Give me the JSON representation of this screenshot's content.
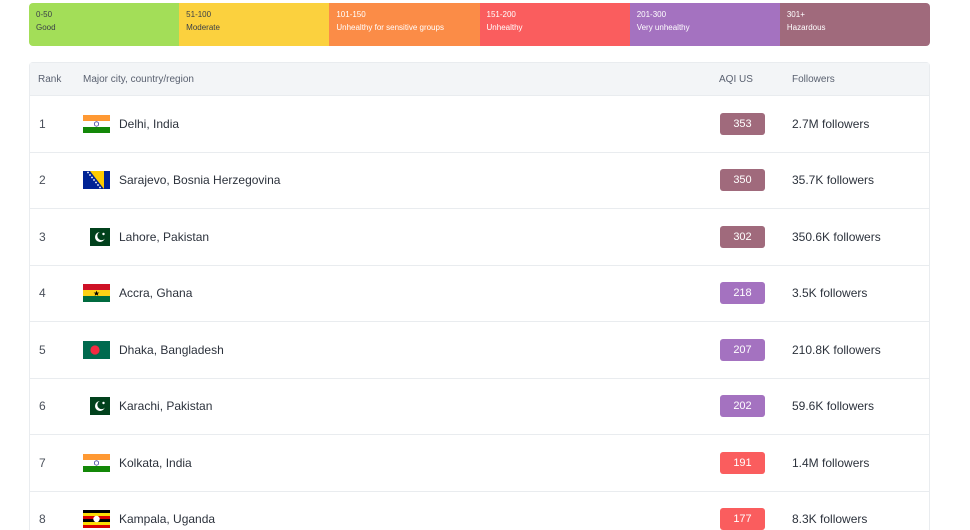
{
  "legend": [
    {
      "range": "0-50",
      "label": "Good",
      "color": "#a3de58"
    },
    {
      "range": "51-100",
      "label": "Moderate",
      "color": "#fbd13e"
    },
    {
      "range": "101-150",
      "label": "Unhealthy for sensitive groups",
      "color": "#fb8c47"
    },
    {
      "range": "151-200",
      "label": "Unhealthy",
      "color": "#fa5d5e"
    },
    {
      "range": "201-300",
      "label": "Very unhealthy",
      "color": "#a472c0"
    },
    {
      "range": "301+",
      "label": "Hazardous",
      "color": "#a06a7c"
    }
  ],
  "table": {
    "headers": {
      "rank": "Rank",
      "city": "Major city, country/region",
      "aqi": "AQI US",
      "followers": "Followers"
    },
    "rows": [
      {
        "rank": "1",
        "city": "Delhi, India",
        "flag": "india",
        "aqi": "353",
        "aqi_color": "#a06a7c",
        "followers": "2.7M followers"
      },
      {
        "rank": "2",
        "city": "Sarajevo, Bosnia Herzegovina",
        "flag": "bosnia",
        "aqi": "350",
        "aqi_color": "#a06a7c",
        "followers": "35.7K followers"
      },
      {
        "rank": "3",
        "city": "Lahore, Pakistan",
        "flag": "pakistan",
        "aqi": "302",
        "aqi_color": "#a06a7c",
        "followers": "350.6K followers"
      },
      {
        "rank": "4",
        "city": "Accra, Ghana",
        "flag": "ghana",
        "aqi": "218",
        "aqi_color": "#a472c0",
        "followers": "3.5K followers"
      },
      {
        "rank": "5",
        "city": "Dhaka, Bangladesh",
        "flag": "bangladesh",
        "aqi": "207",
        "aqi_color": "#a472c0",
        "followers": "210.8K followers"
      },
      {
        "rank": "6",
        "city": "Karachi, Pakistan",
        "flag": "pakistan",
        "aqi": "202",
        "aqi_color": "#a472c0",
        "followers": "59.6K followers"
      },
      {
        "rank": "7",
        "city": "Kolkata, India",
        "flag": "india",
        "aqi": "191",
        "aqi_color": "#fa5d5e",
        "followers": "1.4M followers"
      },
      {
        "rank": "8",
        "city": "Kampala, Uganda",
        "flag": "uganda",
        "aqi": "177",
        "aqi_color": "#fa5d5e",
        "followers": "8.3K followers"
      }
    ]
  }
}
